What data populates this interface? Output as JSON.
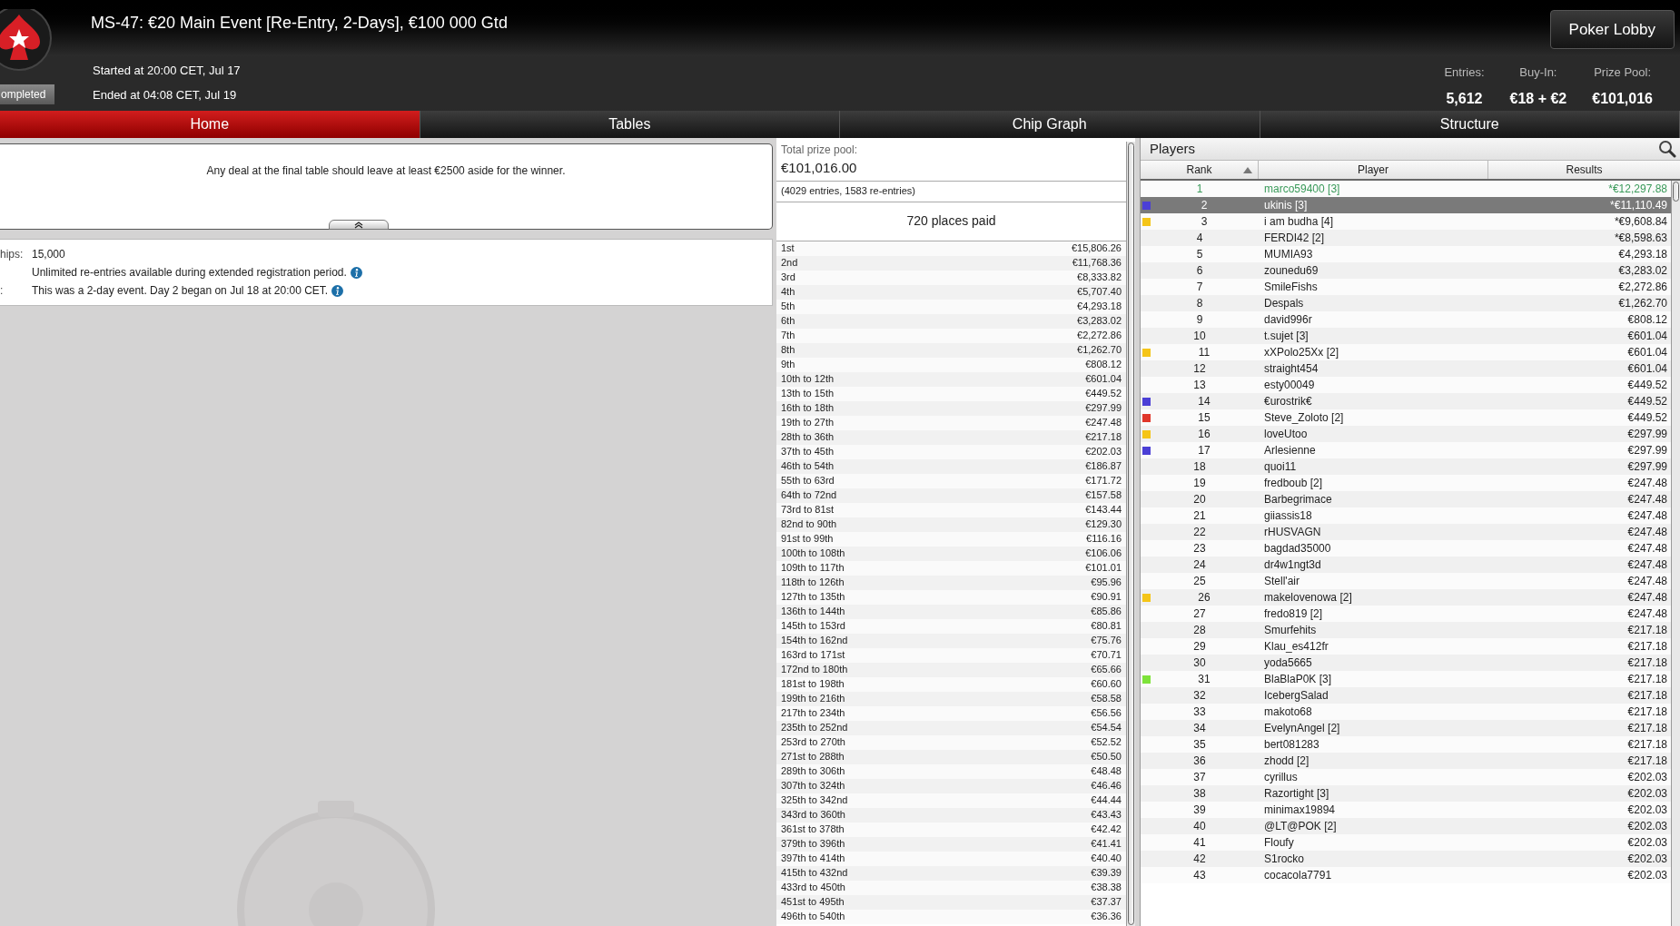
{
  "header": {
    "title": "MS-47: €20 Main Event [Re-Entry, 2-Days], €100 000 Gtd",
    "status": "ompleted",
    "started": "Started at 20:00 CET, Jul 17",
    "ended": "Ended at 04:08 CET, Jul 19",
    "lobby_button": "Poker Lobby",
    "stats": [
      {
        "label": "Entries:",
        "value": "5,612"
      },
      {
        "label": "Buy-In:",
        "value": "€18 + €2"
      },
      {
        "label": "Prize Pool:",
        "value": "€101,016"
      }
    ]
  },
  "tabs": [
    {
      "label": "Home",
      "selected": true
    },
    {
      "label": "Tables",
      "selected": false
    },
    {
      "label": "Chip Graph",
      "selected": false
    },
    {
      "label": "Structure",
      "selected": false
    }
  ],
  "announcement": "Any deal at the final table should leave at least €2500 aside for the winner.",
  "info": [
    {
      "label": "hips:",
      "value": "15,000",
      "info_icon": false
    },
    {
      "value": "Unlimited re-entries available during extended registration period.",
      "info_icon": true
    },
    {
      "label": ":",
      "value": "This was a 2-day event. Day 2 began on Jul 18 at 20:00 CET.",
      "info_icon": true
    }
  ],
  "prize_pool": {
    "label": "Total prize pool:",
    "amount": "€101,016.00",
    "entries_note": "(4029 entries, 1583 re-entries)",
    "places_paid": "720 places paid",
    "payouts": [
      [
        "1st",
        "€15,806.26"
      ],
      [
        "2nd",
        "€11,768.36"
      ],
      [
        "3rd",
        "€8,333.82"
      ],
      [
        "4th",
        "€5,707.40"
      ],
      [
        "5th",
        "€4,293.18"
      ],
      [
        "6th",
        "€3,283.02"
      ],
      [
        "7th",
        "€2,272.86"
      ],
      [
        "8th",
        "€1,262.70"
      ],
      [
        "9th",
        "€808.12"
      ],
      [
        "10th to 12th",
        "€601.04"
      ],
      [
        "13th to 15th",
        "€449.52"
      ],
      [
        "16th to 18th",
        "€297.99"
      ],
      [
        "19th to 27th",
        "€247.48"
      ],
      [
        "28th to 36th",
        "€217.18"
      ],
      [
        "37th to 45th",
        "€202.03"
      ],
      [
        "46th to 54th",
        "€186.87"
      ],
      [
        "55th to 63rd",
        "€171.72"
      ],
      [
        "64th to 72nd",
        "€157.58"
      ],
      [
        "73rd to 81st",
        "€143.44"
      ],
      [
        "82nd to 90th",
        "€129.30"
      ],
      [
        "91st to 99th",
        "€116.16"
      ],
      [
        "100th to 108th",
        "€106.06"
      ],
      [
        "109th to 117th",
        "€101.01"
      ],
      [
        "118th to 126th",
        "€95.96"
      ],
      [
        "127th to 135th",
        "€90.91"
      ],
      [
        "136th to 144th",
        "€85.86"
      ],
      [
        "145th to 153rd",
        "€80.81"
      ],
      [
        "154th to 162nd",
        "€75.76"
      ],
      [
        "163rd to 171st",
        "€70.71"
      ],
      [
        "172nd to 180th",
        "€65.66"
      ],
      [
        "181st to 198th",
        "€60.60"
      ],
      [
        "199th to 216th",
        "€58.58"
      ],
      [
        "217th to 234th",
        "€56.56"
      ],
      [
        "235th to 252nd",
        "€54.54"
      ],
      [
        "253rd to 270th",
        "€52.52"
      ],
      [
        "271st to 288th",
        "€50.50"
      ],
      [
        "289th to 306th",
        "€48.48"
      ],
      [
        "307th to 324th",
        "€46.46"
      ],
      [
        "325th to 342nd",
        "€44.44"
      ],
      [
        "343rd to 360th",
        "€43.43"
      ],
      [
        "361st to 378th",
        "€42.42"
      ],
      [
        "379th to 396th",
        "€41.41"
      ],
      [
        "397th to 414th",
        "€40.40"
      ],
      [
        "415th to 432nd",
        "€39.39"
      ],
      [
        "433rd to 450th",
        "€38.38"
      ],
      [
        "451st to 495th",
        "€37.37"
      ],
      [
        "496th to 540th",
        "€36.36"
      ]
    ]
  },
  "players": {
    "title": "Players",
    "columns": [
      "Rank",
      "Player",
      "Results"
    ],
    "rows": [
      {
        "rank": "1",
        "player": "marco59400 [3]",
        "result": "*€12,297.88",
        "selected": false,
        "winner": true
      },
      {
        "rank": "2",
        "player": "ukinis [3]",
        "result": "*€11,110.49",
        "selected": true,
        "winner": false,
        "color": "#4b3fd6"
      },
      {
        "rank": "3",
        "player": "i am budha [4]",
        "result": "*€9,608.84",
        "selected": false,
        "winner": false,
        "color": "#f5c518"
      },
      {
        "rank": "4",
        "player": "FERDI42 [2]",
        "result": "*€8,598.63",
        "selected": false,
        "winner": false
      },
      {
        "rank": "5",
        "player": "MUMIA93",
        "result": "€4,293.18",
        "selected": false,
        "winner": false
      },
      {
        "rank": "6",
        "player": "zounedu69",
        "result": "€3,283.02",
        "selected": false,
        "winner": false
      },
      {
        "rank": "7",
        "player": "SmileFishs",
        "result": "€2,272.86",
        "selected": false,
        "winner": false
      },
      {
        "rank": "8",
        "player": "Despals",
        "result": "€1,262.70",
        "selected": false,
        "winner": false
      },
      {
        "rank": "9",
        "player": "david996r",
        "result": "€808.12",
        "selected": false,
        "winner": false
      },
      {
        "rank": "10",
        "player": "t.sujet [3]",
        "result": "€601.04",
        "selected": false,
        "winner": false
      },
      {
        "rank": "11",
        "player": "xXPolo25Xx [2]",
        "result": "€601.04",
        "selected": false,
        "winner": false,
        "color": "#f5c518"
      },
      {
        "rank": "12",
        "player": "straight454",
        "result": "€601.04",
        "selected": false,
        "winner": false
      },
      {
        "rank": "13",
        "player": "esty00049",
        "result": "€449.52",
        "selected": false,
        "winner": false
      },
      {
        "rank": "14",
        "player": "€urostrik€",
        "result": "€449.52",
        "selected": false,
        "winner": false,
        "color": "#4b3fd6"
      },
      {
        "rank": "15",
        "player": "Steve_Zoloto [2]",
        "result": "€449.52",
        "selected": false,
        "winner": false,
        "color": "#e0362a"
      },
      {
        "rank": "16",
        "player": "loveUtoo",
        "result": "€297.99",
        "selected": false,
        "winner": false,
        "color": "#f5c518"
      },
      {
        "rank": "17",
        "player": "Arlesienne",
        "result": "€297.99",
        "selected": false,
        "winner": false,
        "color": "#4b3fd6"
      },
      {
        "rank": "18",
        "player": "quoi11",
        "result": "€297.99",
        "selected": false,
        "winner": false
      },
      {
        "rank": "19",
        "player": "fredboub [2]",
        "result": "€247.48",
        "selected": false,
        "winner": false
      },
      {
        "rank": "20",
        "player": "Barbegrimace",
        "result": "€247.48",
        "selected": false,
        "winner": false
      },
      {
        "rank": "21",
        "player": "giiassis18",
        "result": "€247.48",
        "selected": false,
        "winner": false
      },
      {
        "rank": "22",
        "player": "rHUSVAGN",
        "result": "€247.48",
        "selected": false,
        "winner": false
      },
      {
        "rank": "23",
        "player": "bagdad35000",
        "result": "€247.48",
        "selected": false,
        "winner": false
      },
      {
        "rank": "24",
        "player": "dr4w1ngt3d",
        "result": "€247.48",
        "selected": false,
        "winner": false
      },
      {
        "rank": "25",
        "player": "Stell'air",
        "result": "€247.48",
        "selected": false,
        "winner": false
      },
      {
        "rank": "26",
        "player": "makelovenowa [2]",
        "result": "€247.48",
        "selected": false,
        "winner": false,
        "color": "#f5c518"
      },
      {
        "rank": "27",
        "player": "fredo819 [2]",
        "result": "€247.48",
        "selected": false,
        "winner": false
      },
      {
        "rank": "28",
        "player": "Smurfehits",
        "result": "€217.18",
        "selected": false,
        "winner": false
      },
      {
        "rank": "29",
        "player": "Klau_es412fr",
        "result": "€217.18",
        "selected": false,
        "winner": false
      },
      {
        "rank": "30",
        "player": "yoda5665",
        "result": "€217.18",
        "selected": false,
        "winner": false
      },
      {
        "rank": "31",
        "player": "BlaBlaP0K [3]",
        "result": "€217.18",
        "selected": false,
        "winner": false,
        "color": "#7ee33a"
      },
      {
        "rank": "32",
        "player": "IcebergSalad",
        "result": "€217.18",
        "selected": false,
        "winner": false
      },
      {
        "rank": "33",
        "player": "makoto68",
        "result": "€217.18",
        "selected": false,
        "winner": false
      },
      {
        "rank": "34",
        "player": "EvelynAngel [2]",
        "result": "€217.18",
        "selected": false,
        "winner": false
      },
      {
        "rank": "35",
        "player": "bert081283",
        "result": "€217.18",
        "selected": false,
        "winner": false
      },
      {
        "rank": "36",
        "player": "zhodd [2]",
        "result": "€217.18",
        "selected": false,
        "winner": false
      },
      {
        "rank": "37",
        "player": "cyrillus",
        "result": "€202.03",
        "selected": false,
        "winner": false
      },
      {
        "rank": "38",
        "player": "Razortight [3]",
        "result": "€202.03",
        "selected": false,
        "winner": false
      },
      {
        "rank": "39",
        "player": "minimax19894",
        "result": "€202.03",
        "selected": false,
        "winner": false
      },
      {
        "rank": "40",
        "player": "@LT@POK [2]",
        "result": "€202.03",
        "selected": false,
        "winner": false
      },
      {
        "rank": "41",
        "player": "Floufy",
        "result": "€202.03",
        "selected": false,
        "winner": false
      },
      {
        "rank": "42",
        "player": "S1rocko",
        "result": "€202.03",
        "selected": false,
        "winner": false
      },
      {
        "rank": "43",
        "player": "cocacola7791",
        "result": "€202.03",
        "selected": false,
        "winner": false
      }
    ]
  }
}
